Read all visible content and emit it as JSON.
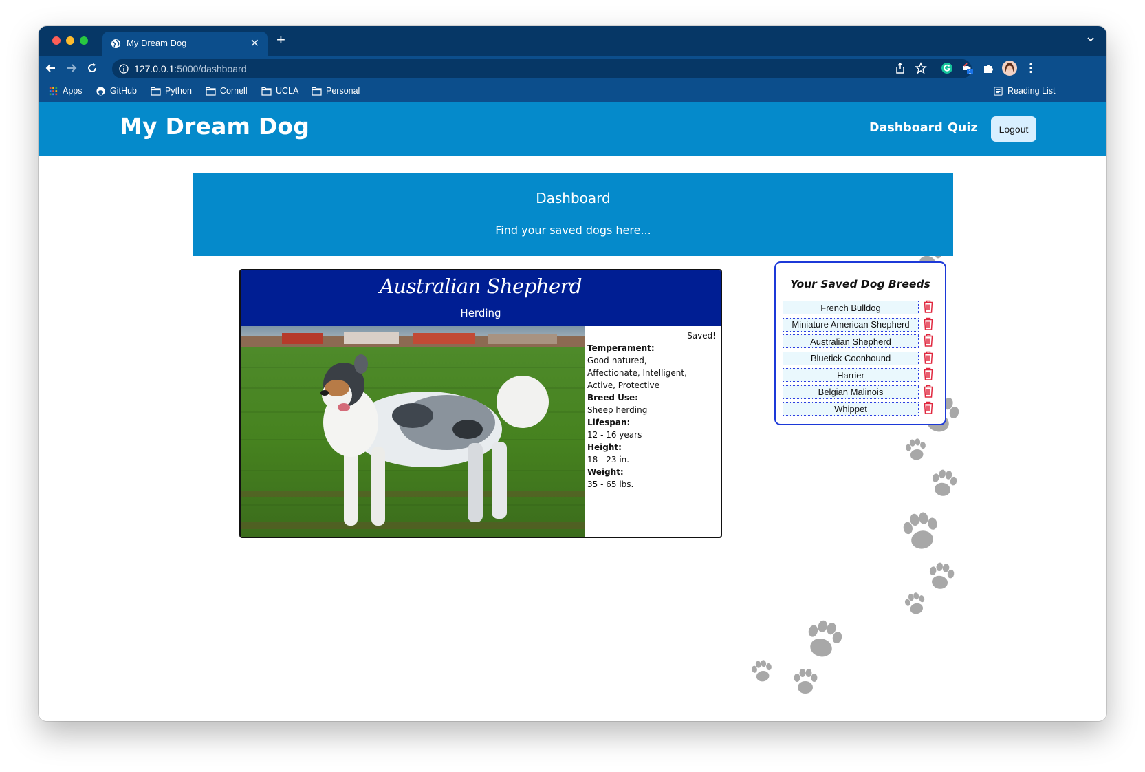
{
  "browser": {
    "tab_title": "My Dream Dog",
    "new_tab": "+",
    "tab_close": "✕",
    "url_host": "127.0.0.1",
    "url_rest": ":5000/dashboard",
    "bookmarks": [
      "Apps",
      "GitHub",
      "Python",
      "Cornell",
      "UCLA",
      "Personal"
    ],
    "reading_list": "Reading List",
    "extension_badge": "1"
  },
  "navbar": {
    "brand": "My Dream Dog",
    "links": [
      "Dashboard",
      "Quiz"
    ],
    "logout": "Logout"
  },
  "header": {
    "title": "Dashboard",
    "subtitle": "Find your saved dogs here..."
  },
  "dog_card": {
    "name": "Australian Shepherd",
    "group": "Herding",
    "status": "Saved!",
    "fields": [
      {
        "label": "Temperament:",
        "value": "Good-natured, Affectionate, Intelligent, Active, Protective"
      },
      {
        "label": "Breed Use:",
        "value": "Sheep herding"
      },
      {
        "label": "Lifespan:",
        "value": "12 - 16 years"
      },
      {
        "label": "Height:",
        "value": "18 - 23 in."
      },
      {
        "label": "Weight:",
        "value": "35 - 65 lbs."
      }
    ]
  },
  "saved_breeds": {
    "heading": "Your Saved Dog Breeds",
    "items": [
      "French Bulldog",
      "Miniature American Shepherd",
      "Australian Shepherd",
      "Bluetick Coonhound",
      "Harrier",
      "Belgian Malinois",
      "Whippet"
    ]
  },
  "colors": {
    "navbar": "#058acb",
    "card_header": "#001e93",
    "saved_border": "#1c39d8",
    "trash": "#e0283f",
    "paw": "#a8a8a8"
  }
}
